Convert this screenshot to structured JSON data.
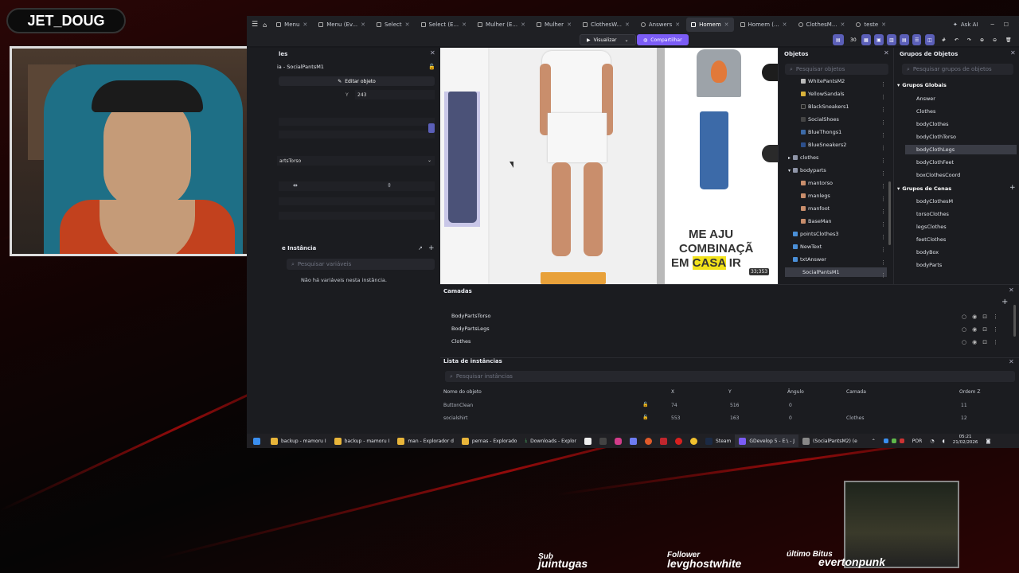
{
  "streamer": {
    "name": "JET_DOUG"
  },
  "tabs": [
    {
      "label": "Menu"
    },
    {
      "label": "Menu (Ev..."
    },
    {
      "label": "Select"
    },
    {
      "label": "Select (E..."
    },
    {
      "label": "Mulher (E..."
    },
    {
      "label": "Mulher"
    },
    {
      "label": "ClothesW..."
    },
    {
      "label": "Answers"
    },
    {
      "label": "Homem",
      "active": true
    },
    {
      "label": "Homem (..."
    },
    {
      "label": "ClothesM..."
    },
    {
      "label": "teste"
    }
  ],
  "window": {
    "ask_ai": "Ask AI"
  },
  "toolbar": {
    "preview": "Visualizar",
    "share": "Compartilhar",
    "zoom": "30"
  },
  "properties": {
    "title": "les",
    "object_name": "ia - SocialPantsM1",
    "edit_object": "Editar objeto",
    "y_label": "Y",
    "y_value": "243",
    "layer_value": "artsTorso",
    "variables_title": "e Instância",
    "variables_search_placeholder": "Pesquisar variáveis",
    "no_variables": "Não há variáveis nesta instância."
  },
  "scene": {
    "cta_line1": "ME AJU",
    "cta_line2": "COMBINAÇÃ",
    "cta_line3a": "EM ",
    "cta_line3b": "CASA",
    "cta_line3c": " IR",
    "coords": "33;353"
  },
  "objects_panel": {
    "title": "Objetos",
    "search_placeholder": "Pesquisar objetos",
    "items": [
      {
        "label": "WhitePantsM2",
        "indent": 1
      },
      {
        "label": "YellowSandals",
        "indent": 1
      },
      {
        "label": "BlackSneakers1",
        "indent": 1
      },
      {
        "label": "SocialShoes",
        "indent": 1
      },
      {
        "label": "BlueThongs1",
        "indent": 1
      },
      {
        "label": "BlueSneakers2",
        "indent": 1
      },
      {
        "label": "clothes",
        "indent": 0
      },
      {
        "label": "bodyparts",
        "indent": 0
      },
      {
        "label": "mantorso",
        "indent": 1
      },
      {
        "label": "manlegs",
        "indent": 1
      },
      {
        "label": "manfoot",
        "indent": 1
      },
      {
        "label": "BaseMan",
        "indent": 1
      },
      {
        "label": "pointsClothes3",
        "indent": 0
      },
      {
        "label": "NewText",
        "indent": 0
      },
      {
        "label": "txtAnswer",
        "indent": 0
      },
      {
        "label": "SocialPantsM1",
        "indent": 0,
        "selected": true
      }
    ]
  },
  "groups_panel": {
    "title": "Grupos de Objetos",
    "search_placeholder": "Pesquisar grupos de objetos",
    "global_title": "Grupos Globais",
    "global_items": [
      "Answer",
      "Clothes",
      "bodyClothes",
      "bodyClothTorso",
      "bodyClothLegs",
      "bodyClothFeet",
      "boxClothesCoord"
    ],
    "scene_title": "Grupos de Cenas",
    "scene_items": [
      "bodyClothesM",
      "torsoClothes",
      "legsClothes",
      "feetClothes",
      "bodyBox",
      "bodyParts"
    ]
  },
  "layers_panel": {
    "title": "Camadas",
    "items": [
      "BodyPartsTorso",
      "BodyPartsLegs",
      "Clothes"
    ]
  },
  "instances_panel": {
    "title": "Lista de instâncias",
    "search_placeholder": "Pesquisar instâncias",
    "columns": [
      "Nome do objeto",
      "X",
      "Y",
      "Ângulo",
      "Camada",
      "Ordem Z"
    ],
    "rows": [
      [
        "ButtonClean",
        "74",
        "516",
        "0",
        "",
        "11"
      ],
      [
        "socialshirt",
        "553",
        "163",
        "0",
        "Clothes",
        "12"
      ]
    ]
  },
  "taskbar": {
    "items": [
      "backup - mamoru I",
      "backup - mamoru I",
      "man - Explorador d",
      "pernas - Explorado",
      "Downloads - Explor",
      "Steam",
      "GDevelop 5 - E:\\ - J",
      "(SocialPantsM2) (e"
    ],
    "lang": "POR",
    "time": "05:21",
    "date": "21/02/2026"
  },
  "stream_overlay": {
    "sub_label": "Sub",
    "sub_name": "juintugas",
    "follower_label": "Follower",
    "follower_name": "levghostwhite",
    "bits_label": "último Bitus",
    "bits_name": "evertonpunk"
  },
  "colors": {
    "accent": "#7b5cf6",
    "selection": "#3a3c45",
    "background": "#17181c",
    "streak": "#b40c0c"
  }
}
